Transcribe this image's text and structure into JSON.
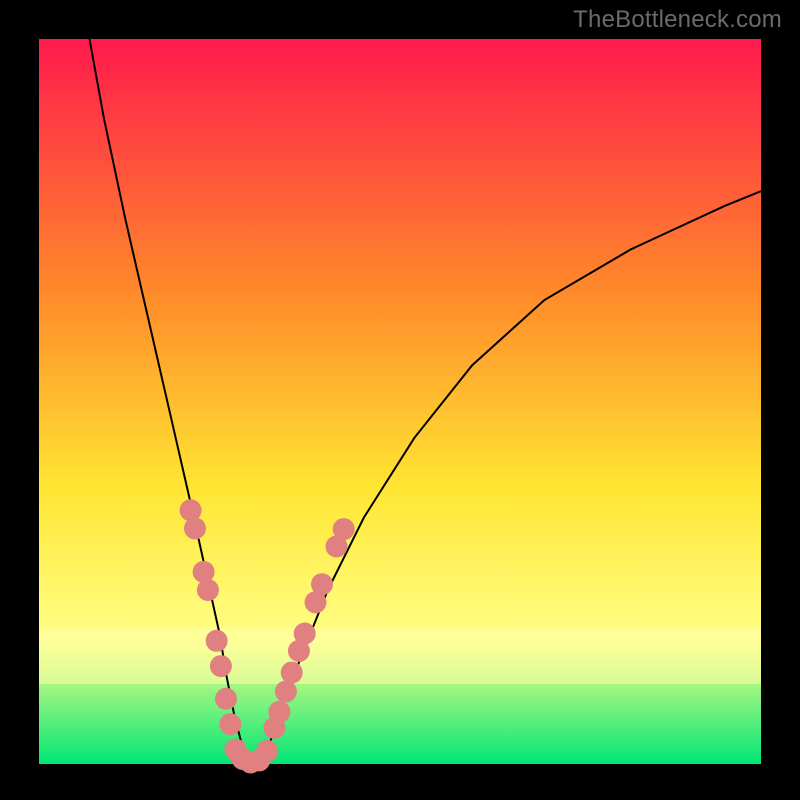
{
  "watermark": "TheBottleneck.com",
  "chart_data": {
    "type": "line",
    "title": "",
    "xlabel": "",
    "ylabel": "",
    "xlim": [
      0,
      100
    ],
    "ylim": [
      0,
      100
    ],
    "axes_visible": false,
    "grid": false,
    "legend": false,
    "background_gradient": {
      "top": "#FF1A4D",
      "mid1": "#FF8A2A",
      "mid2": "#FFE633",
      "lower": "#FFFF88",
      "bottom": "#00E676"
    },
    "curve_description": "V-shaped bottleneck curve: steep descent from upper-left, minimum around x≈28, then curved ascent toward upper-right.",
    "series": [
      {
        "name": "bottleneck-curve",
        "color": "#000000",
        "x": [
          7,
          9,
          12,
          15,
          18,
          21,
          23,
          25,
          26,
          27,
          28,
          29,
          30,
          31,
          32,
          33,
          34,
          36,
          40,
          45,
          52,
          60,
          70,
          82,
          95,
          100
        ],
        "y": [
          100,
          89,
          75,
          62,
          49,
          36,
          27,
          18,
          12,
          7,
          3,
          1,
          0,
          1,
          3,
          6,
          9,
          14,
          24,
          34,
          45,
          55,
          64,
          71,
          77,
          79
        ]
      },
      {
        "name": "beads-left",
        "type": "scatter",
        "color": "#E08080",
        "x": [
          21.0,
          21.6,
          22.8,
          23.4,
          24.6,
          25.2,
          25.9,
          26.5
        ],
        "y": [
          35.0,
          32.5,
          26.5,
          24.0,
          17.0,
          13.5,
          9.0,
          5.5
        ]
      },
      {
        "name": "beads-bottom",
        "type": "scatter",
        "color": "#E08080",
        "x": [
          27.2,
          28.2,
          29.3,
          30.5,
          31.6
        ],
        "y": [
          2.0,
          0.7,
          0.2,
          0.5,
          1.8
        ]
      },
      {
        "name": "beads-right",
        "type": "scatter",
        "color": "#E08080",
        "x": [
          32.6,
          33.3,
          34.2,
          35.0,
          36.0,
          36.8,
          38.3,
          39.2,
          41.2,
          42.2
        ],
        "y": [
          5.0,
          7.2,
          10.0,
          12.6,
          15.6,
          18.0,
          22.3,
          24.8,
          30.0,
          32.4
        ]
      }
    ]
  }
}
